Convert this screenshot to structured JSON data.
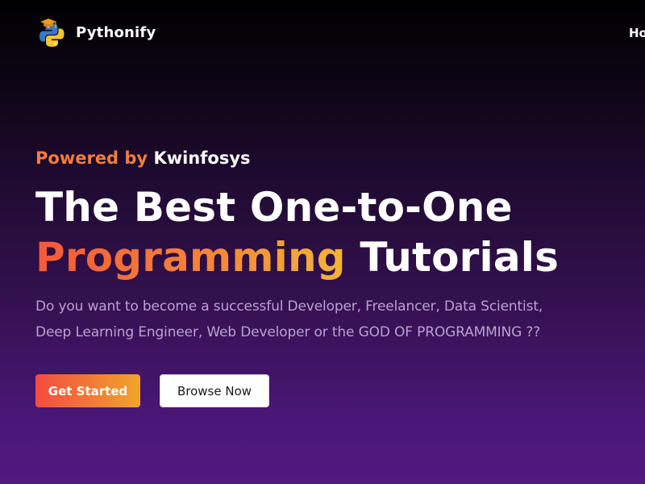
{
  "brand": {
    "name": "Pythonify",
    "logo_icon": "python-graduation-cap-icon"
  },
  "nav": {
    "items": [
      {
        "label": "Ho"
      }
    ]
  },
  "hero": {
    "tagline_prefix": "Powered by",
    "tagline_company": "Kwinfosys",
    "headline_line1": "The Best One-to-One",
    "headline_highlight": "Programming",
    "headline_rest": "Tutorials",
    "description_line1": "Do you want to become a successful Developer, Freelancer, Data Scientist,",
    "description_line2": "Deep Learning Engineer, Web Developer or the GOD OF PROGRAMMING ??"
  },
  "buttons": {
    "primary_label": "Get Started",
    "secondary_label": "Browse Now"
  },
  "colors": {
    "accent_orange": "#f57c3c",
    "gradient_start": "#f24c3f",
    "gradient_end": "#f2a52a",
    "description_text": "#b9a2d1",
    "background_bottom": "#52197f"
  }
}
